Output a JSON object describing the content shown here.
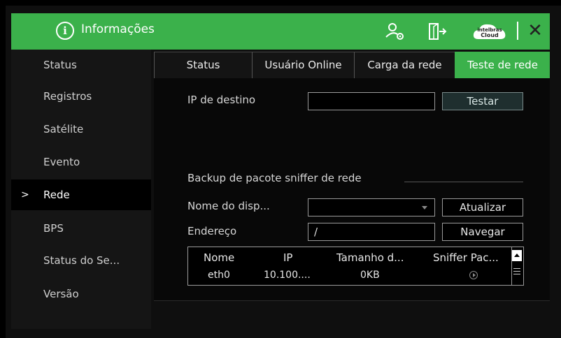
{
  "titlebar": {
    "title": "Informações",
    "info_icon_glyph": "i",
    "cloud_label_top": "intelbras",
    "cloud_label_bottom": "Cloud",
    "close_glyph": "✕"
  },
  "sidebar": {
    "items": [
      {
        "label": "Status"
      },
      {
        "label": "Registros"
      },
      {
        "label": "Satélite"
      },
      {
        "label": "Evento"
      },
      {
        "label": "Rede"
      },
      {
        "label": "BPS"
      },
      {
        "label": "Status do Se..."
      },
      {
        "label": "Versão"
      }
    ],
    "active_chevron": ">"
  },
  "tabs": [
    {
      "label": "Status"
    },
    {
      "label": "Usuário Online"
    },
    {
      "label": "Carga da rede"
    },
    {
      "label": "Teste de rede"
    }
  ],
  "test": {
    "ip_label": "IP de destino",
    "ip_value": "",
    "test_button": "Testar"
  },
  "sniffer": {
    "section_title": "Backup de pacote sniffer de rede",
    "device_label": "Nome do disp...",
    "device_value": "",
    "refresh_button": "Atualizar",
    "address_label": "Endereço",
    "address_value": "/",
    "browse_button": "Navegar",
    "table": {
      "headers": [
        "Nome",
        "IP",
        "Tamanho d...",
        "Sniffer Pac..."
      ],
      "rows": [
        {
          "name": "eth0",
          "ip": "10.100....",
          "size": "0KB"
        }
      ]
    }
  },
  "colors": {
    "accent": "#3bb14b"
  }
}
